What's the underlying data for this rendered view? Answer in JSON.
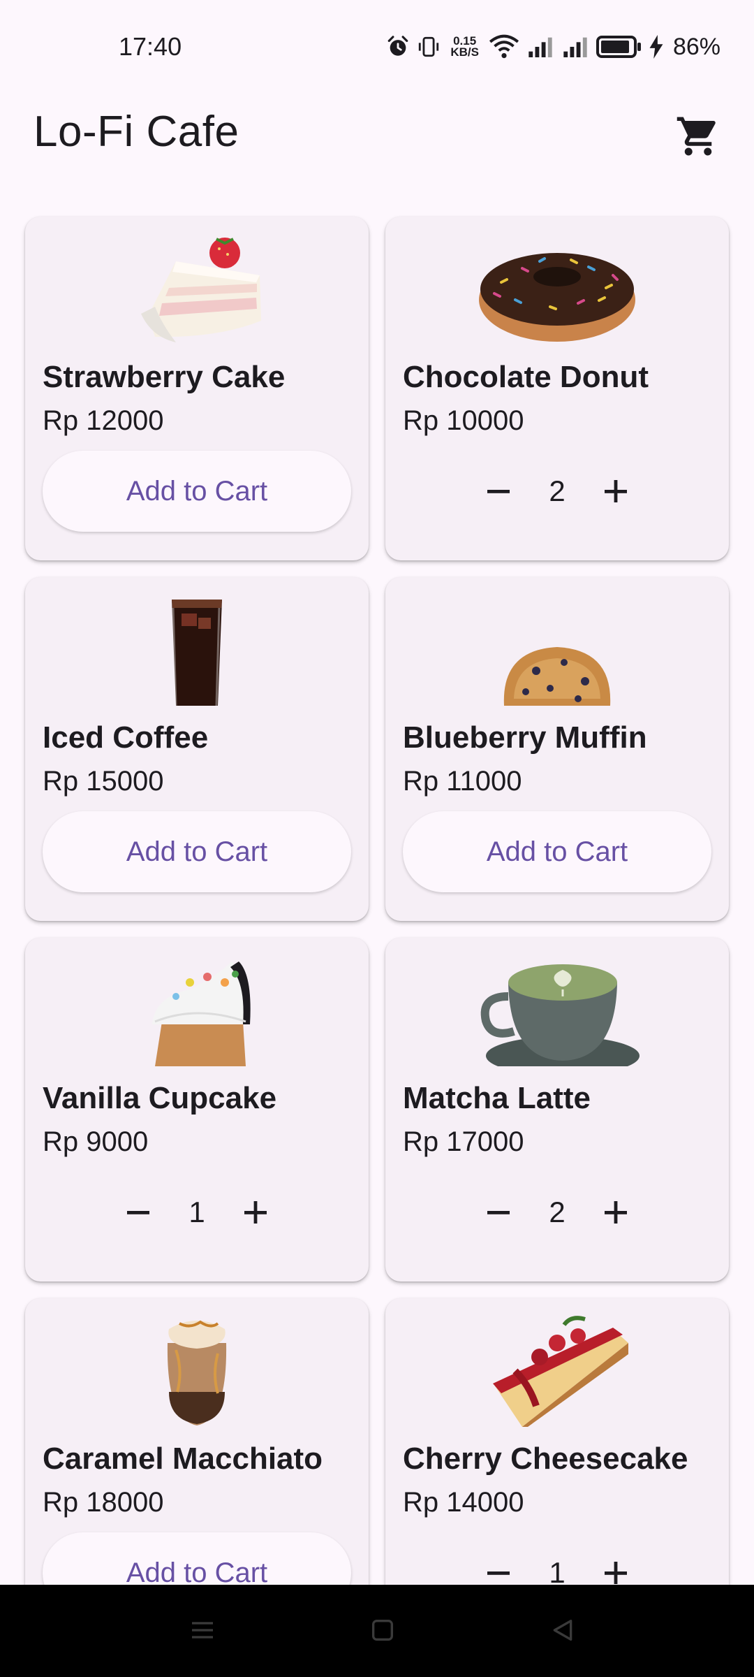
{
  "status_bar": {
    "time": "17:40",
    "net_speed_value": "0.15",
    "net_speed_unit": "KB/S",
    "battery_percent": "86%"
  },
  "app_bar": {
    "title": "Lo-Fi Cafe",
    "cart_icon": "shopping-cart-icon"
  },
  "products": [
    {
      "name": "Strawberry Cake",
      "price": "Rp 12000",
      "action": "Add to Cart"
    },
    {
      "name": "Chocolate Donut",
      "price": "Rp 10000",
      "quantity": "2"
    },
    {
      "name": "Iced Coffee",
      "price": "Rp 15000",
      "action": "Add to Cart"
    },
    {
      "name": "Blueberry Muffin",
      "price": "Rp 11000",
      "action": "Add to Cart"
    },
    {
      "name": "Vanilla Cupcake",
      "price": "Rp 9000",
      "quantity": "1"
    },
    {
      "name": "Matcha Latte",
      "price": "Rp 17000",
      "quantity": "2"
    },
    {
      "name": "Caramel Macchiato",
      "price": "Rp 18000",
      "action": "Add to Cart"
    },
    {
      "name": "Cherry Cheesecake",
      "price": "Rp 14000",
      "quantity": "1"
    }
  ],
  "colors": {
    "background": "#fdf7fd",
    "card": "#f6eff6",
    "accent": "#6750a4",
    "text": "#1d1b20"
  },
  "nav_bar": {
    "icons": [
      "menu-icon",
      "home-square-icon",
      "back-triangle-icon"
    ]
  }
}
